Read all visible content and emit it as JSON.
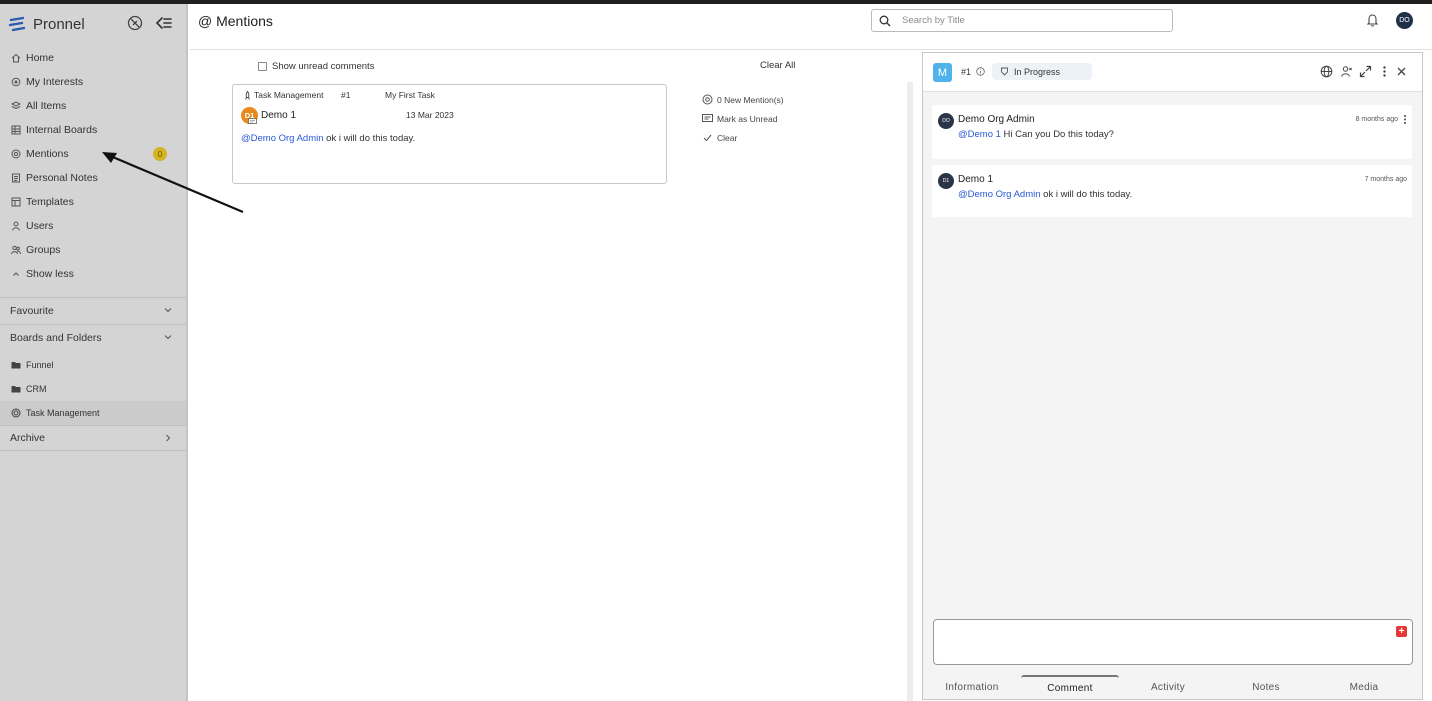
{
  "app": {
    "name": "Pronnel"
  },
  "nav": {
    "items": [
      {
        "label": "Home",
        "icon": "home-icon"
      },
      {
        "label": "My Interests",
        "icon": "interests-icon"
      },
      {
        "label": "All Items",
        "icon": "all-items-icon"
      },
      {
        "label": "Internal Boards",
        "icon": "boards-icon"
      },
      {
        "label": "Mentions",
        "icon": "at-icon",
        "badge": "0"
      },
      {
        "label": "Personal Notes",
        "icon": "notes-icon"
      },
      {
        "label": "Templates",
        "icon": "templates-icon"
      },
      {
        "label": "Users",
        "icon": "user-icon"
      },
      {
        "label": "Groups",
        "icon": "groups-icon"
      },
      {
        "label": "Show less",
        "icon": "chevron-up-icon"
      }
    ],
    "favourite": "Favourite",
    "boards_and_folders": "Boards and Folders",
    "folders": [
      {
        "label": "Funnel",
        "icon": "folder-icon"
      },
      {
        "label": "CRM",
        "icon": "folder-icon"
      },
      {
        "label": "Task Management",
        "icon": "board-icon"
      }
    ],
    "archive": "Archive"
  },
  "header": {
    "title": "@ Mentions",
    "search_placeholder": "Search by Title",
    "user_initials": "DO"
  },
  "mentions": {
    "show_unread_label": "Show unread comments",
    "clear_all_label": "Clear All",
    "card": {
      "board": "Task Management",
      "item_number": "#1",
      "item_title": "My First Task",
      "author_initials": "D1",
      "author": "Demo 1",
      "date": "13 Mar 2023",
      "mention": "@Demo Org Admin",
      "message": " ok i will do this today."
    },
    "actions": {
      "new_mentions": "0 New Mention(s)",
      "mark_unread": "Mark as Unread",
      "clear": "Clear"
    }
  },
  "detail": {
    "board_initial": "M",
    "item_number": "#1",
    "status": "In Progress",
    "comments": [
      {
        "initials": "DO",
        "author": "Demo Org Admin",
        "time": "8 months ago",
        "mention": "@Demo 1",
        "text": " Hi Can you Do this today?"
      },
      {
        "initials": "D1",
        "author": "Demo 1",
        "time": "7 months ago",
        "mention": "@Demo Org Admin",
        "text": " ok i will do this today."
      }
    ],
    "tabs": [
      "Information",
      "Comment",
      "Activity",
      "Notes",
      "Media"
    ],
    "active_tab": "Comment"
  },
  "colors": {
    "sidebar_bg": "#d4d4d4",
    "accent_blue": "#2a58d6",
    "badge_yellow": "#d4b320",
    "avatar_orange": "#e88a1e",
    "board_badge": "#4fb2ea"
  }
}
